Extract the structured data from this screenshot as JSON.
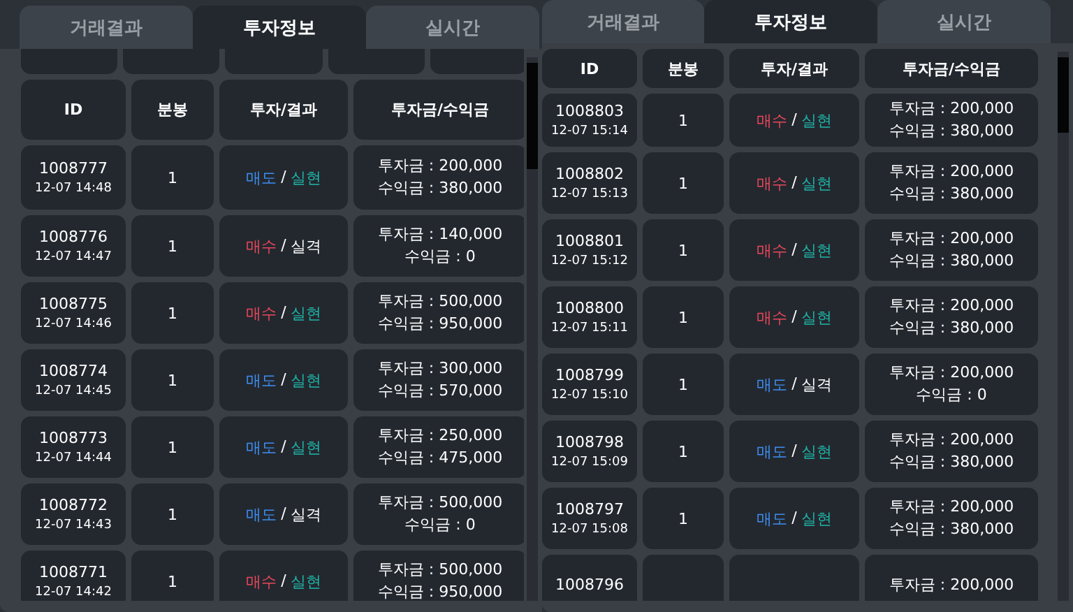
{
  "panels": [
    {
      "tabs": [
        {
          "label": "거래결과",
          "selected": false
        },
        {
          "label": "투자정보",
          "selected": true
        },
        {
          "label": "실시간",
          "selected": false
        }
      ],
      "columns": [
        "ID",
        "분봉",
        "투자/결과",
        "투자금/수익금"
      ],
      "rows": [
        {
          "id": "1008777",
          "time": "12-07 14:48",
          "split": "1",
          "side": {
            "text": "매도",
            "kind": "sell"
          },
          "sep": "/",
          "result": {
            "text": "실현",
            "kind": "win"
          },
          "invest": "투자금 : 200,000",
          "profit": "수익금 : 380,000"
        },
        {
          "id": "1008776",
          "time": "12-07 14:47",
          "split": "1",
          "side": {
            "text": "매수",
            "kind": "buy"
          },
          "sep": "/",
          "result": {
            "text": "실격",
            "kind": "loss"
          },
          "invest": "투자금 : 140,000",
          "profit": "수익금 : 0"
        },
        {
          "id": "1008775",
          "time": "12-07 14:46",
          "split": "1",
          "side": {
            "text": "매수",
            "kind": "buy"
          },
          "sep": "/",
          "result": {
            "text": "실현",
            "kind": "win"
          },
          "invest": "투자금 : 500,000",
          "profit": "수익금 : 950,000"
        },
        {
          "id": "1008774",
          "time": "12-07 14:45",
          "split": "1",
          "side": {
            "text": "매도",
            "kind": "sell"
          },
          "sep": "/",
          "result": {
            "text": "실현",
            "kind": "win"
          },
          "invest": "투자금 : 300,000",
          "profit": "수익금 : 570,000"
        },
        {
          "id": "1008773",
          "time": "12-07 14:44",
          "split": "1",
          "side": {
            "text": "매도",
            "kind": "sell"
          },
          "sep": "/",
          "result": {
            "text": "실현",
            "kind": "win"
          },
          "invest": "투자금 : 250,000",
          "profit": "수익금 : 475,000"
        },
        {
          "id": "1008772",
          "time": "12-07 14:43",
          "split": "1",
          "side": {
            "text": "매도",
            "kind": "sell"
          },
          "sep": "/",
          "result": {
            "text": "실격",
            "kind": "loss"
          },
          "invest": "투자금 : 500,000",
          "profit": "수익금 : 0"
        },
        {
          "id": "1008771",
          "time": "12-07 14:42",
          "split": "1",
          "side": {
            "text": "매수",
            "kind": "buy"
          },
          "sep": "/",
          "result": {
            "text": "실현",
            "kind": "win"
          },
          "invest": "투자금 : 500,000",
          "profit": "수익금 : 950,000"
        }
      ]
    },
    {
      "tabs": [
        {
          "label": "거래결과",
          "selected": false
        },
        {
          "label": "투자정보",
          "selected": true
        },
        {
          "label": "실시간",
          "selected": false
        }
      ],
      "columns": [
        "ID",
        "분봉",
        "투자/결과",
        "투자금/수익금"
      ],
      "rows": [
        {
          "id": "1008803",
          "time": "12-07 15:14",
          "split": "1",
          "side": {
            "text": "매수",
            "kind": "buy"
          },
          "sep": "/",
          "result": {
            "text": "실현",
            "kind": "win"
          },
          "invest": "투자금 : 200,000",
          "profit": "수익금 : 380,000"
        },
        {
          "id": "1008802",
          "time": "12-07 15:13",
          "split": "1",
          "side": {
            "text": "매수",
            "kind": "buy"
          },
          "sep": "/",
          "result": {
            "text": "실현",
            "kind": "win"
          },
          "invest": "투자금 : 200,000",
          "profit": "수익금 : 380,000"
        },
        {
          "id": "1008801",
          "time": "12-07 15:12",
          "split": "1",
          "side": {
            "text": "매수",
            "kind": "buy"
          },
          "sep": "/",
          "result": {
            "text": "실현",
            "kind": "win"
          },
          "invest": "투자금 : 200,000",
          "profit": "수익금 : 380,000"
        },
        {
          "id": "1008800",
          "time": "12-07 15:11",
          "split": "1",
          "side": {
            "text": "매수",
            "kind": "buy"
          },
          "sep": "/",
          "result": {
            "text": "실현",
            "kind": "win"
          },
          "invest": "투자금 : 200,000",
          "profit": "수익금 : 380,000"
        },
        {
          "id": "1008799",
          "time": "12-07 15:10",
          "split": "1",
          "side": {
            "text": "매도",
            "kind": "sell"
          },
          "sep": "/",
          "result": {
            "text": "실격",
            "kind": "loss"
          },
          "invest": "투자금 : 200,000",
          "profit": "수익금 : 0"
        },
        {
          "id": "1008798",
          "time": "12-07 15:09",
          "split": "1",
          "side": {
            "text": "매도",
            "kind": "sell"
          },
          "sep": "/",
          "result": {
            "text": "실현",
            "kind": "win"
          },
          "invest": "투자금 : 200,000",
          "profit": "수익금 : 380,000"
        },
        {
          "id": "1008797",
          "time": "12-07 15:08",
          "split": "1",
          "side": {
            "text": "매도",
            "kind": "sell"
          },
          "sep": "/",
          "result": {
            "text": "실현",
            "kind": "win"
          },
          "invest": "투자금 : 200,000",
          "profit": "수익금 : 380,000"
        },
        {
          "id": "1008796",
          "invest": "투자금 : 200,000"
        }
      ]
    }
  ]
}
